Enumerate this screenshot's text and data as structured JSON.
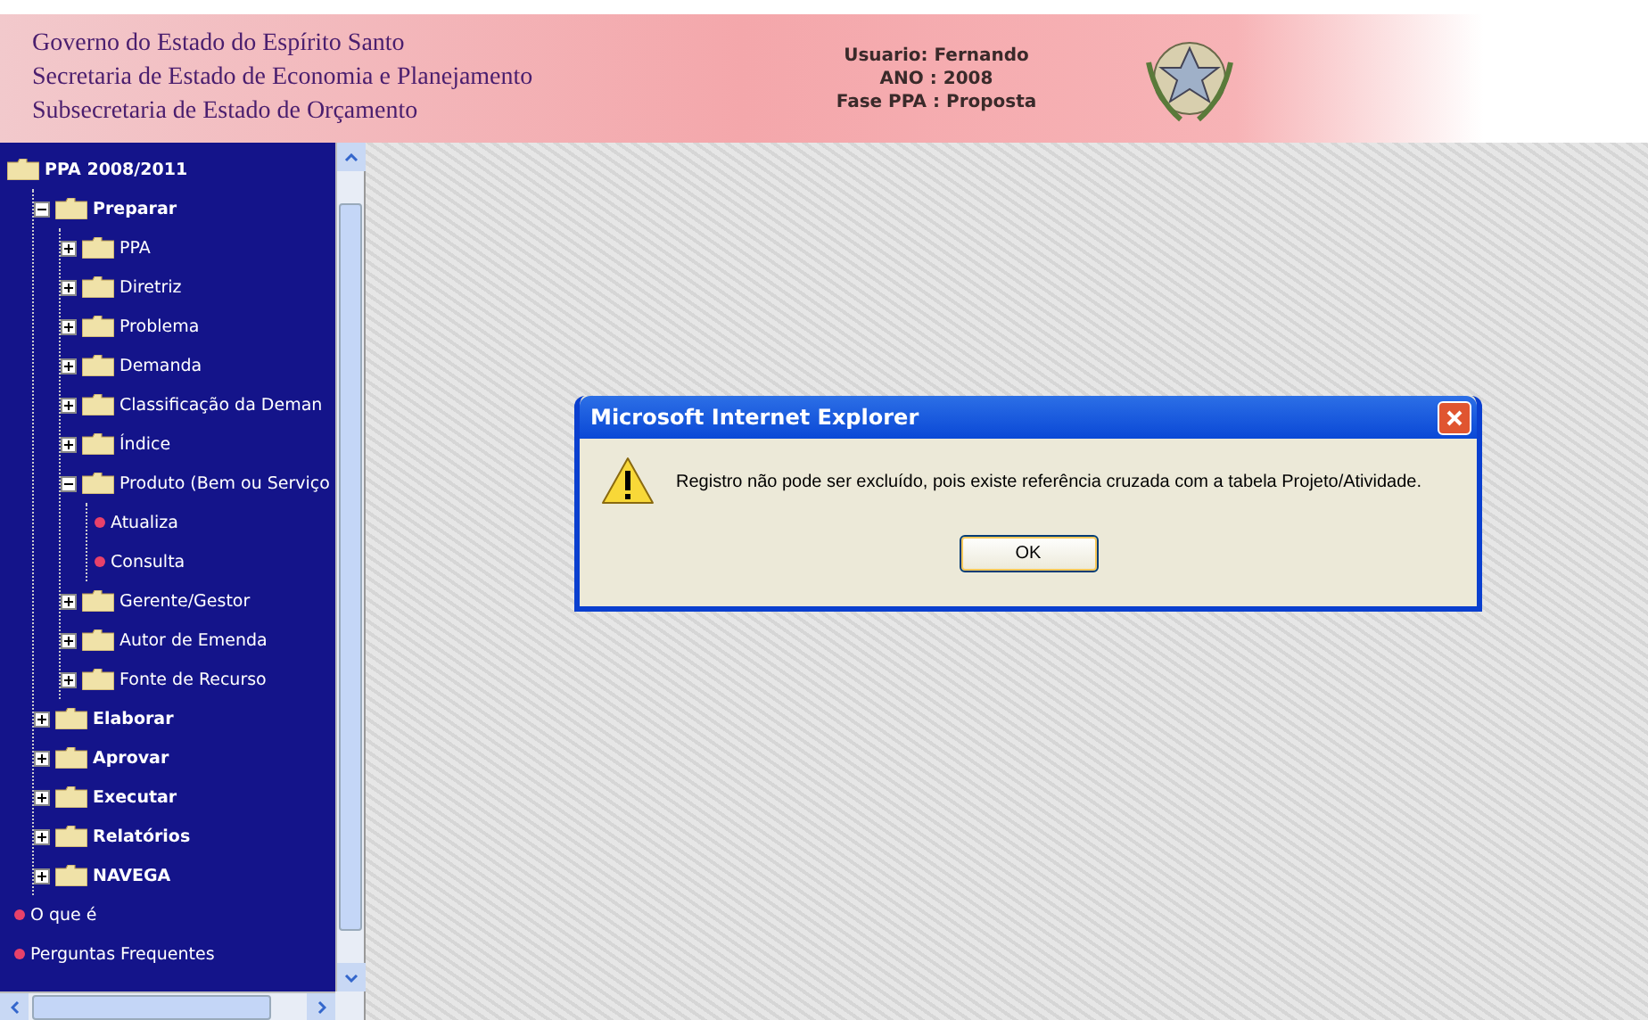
{
  "header": {
    "org_lines": [
      "Governo do Estado do Espírito Santo",
      "Secretaria de Estado de Economia e Planejamento",
      "Subsecretaria de Estado de Orçamento"
    ],
    "info": [
      {
        "label": "Usuario:",
        "value": "Fernando"
      },
      {
        "label": "ANO :",
        "value": "2008"
      },
      {
        "label": "Fase PPA :",
        "value": "Proposta"
      }
    ]
  },
  "sidebar": {
    "tree": [
      {
        "label": "PPA 2008/2011",
        "kind": "folder",
        "children": [
          {
            "label": "Preparar",
            "kind": "folder",
            "expanded": true,
            "children": [
              {
                "label": "PPA",
                "kind": "folder",
                "expanded": false
              },
              {
                "label": "Diretriz",
                "kind": "folder",
                "expanded": false
              },
              {
                "label": "Problema",
                "kind": "folder",
                "expanded": false
              },
              {
                "label": "Demanda",
                "kind": "folder",
                "expanded": false
              },
              {
                "label": "Classificação da Deman",
                "kind": "folder",
                "expanded": false
              },
              {
                "label": "Índice",
                "kind": "folder",
                "expanded": false
              },
              {
                "label": "Produto (Bem ou Serviço",
                "kind": "folder",
                "expanded": true,
                "children": [
                  {
                    "label": "Atualiza",
                    "kind": "leaf"
                  },
                  {
                    "label": "Consulta",
                    "kind": "leaf"
                  }
                ]
              },
              {
                "label": "Gerente/Gestor",
                "kind": "folder",
                "expanded": false
              },
              {
                "label": "Autor de Emenda",
                "kind": "folder",
                "expanded": false
              },
              {
                "label": "Fonte de Recurso",
                "kind": "folder",
                "expanded": false
              }
            ]
          },
          {
            "label": "Elaborar",
            "kind": "folder",
            "expanded": false
          },
          {
            "label": "Aprovar",
            "kind": "folder",
            "expanded": false
          },
          {
            "label": "Executar",
            "kind": "folder",
            "expanded": false
          },
          {
            "label": "Relatórios",
            "kind": "folder",
            "expanded": false
          },
          {
            "label": "NAVEGA",
            "kind": "folder",
            "expanded": false
          }
        ]
      },
      {
        "label": "O que é",
        "kind": "leaf"
      },
      {
        "label": "Perguntas Frequentes",
        "kind": "leaf"
      }
    ]
  },
  "dialog": {
    "title": "Microsoft Internet Explorer",
    "message": "Registro não pode ser excluído, pois existe referência cruzada com a tabela Projeto/Atividade.",
    "buttons": [
      "OK"
    ]
  }
}
